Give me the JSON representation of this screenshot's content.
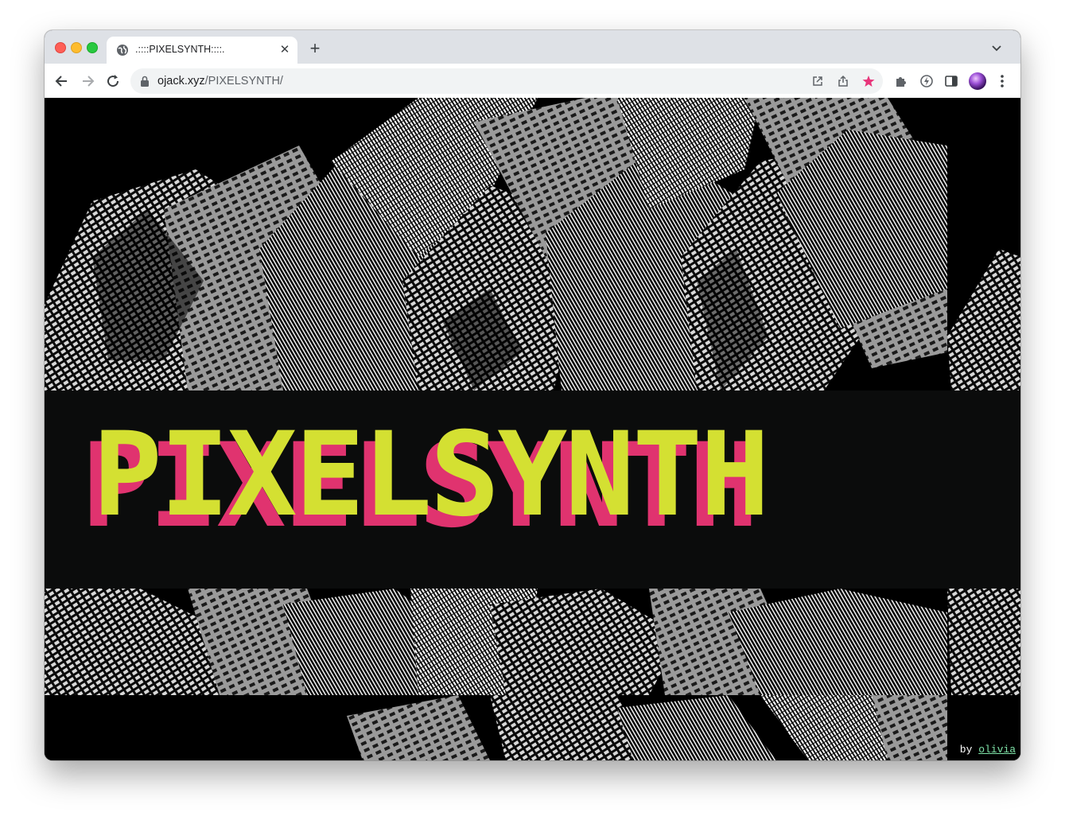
{
  "browser": {
    "tab": {
      "title": ".::::PIXELSYNTH::::.",
      "favicon": "globe-icon"
    },
    "address": {
      "domain": "ojack.xyz",
      "path": "/PIXELSYNTH/"
    },
    "icons": [
      "back-icon",
      "forward-icon",
      "reload-icon",
      "lock-icon",
      "open-in-new-icon",
      "share-icon",
      "bookmark-star-icon",
      "extensions-icon",
      "extension-icon",
      "side-panel-icon",
      "profile-avatar",
      "more-menu-icon"
    ],
    "colors": {
      "bookmark_star": "#e8357a"
    }
  },
  "page": {
    "title_text": "PIXELSYNTH",
    "colors": {
      "title_front": "#d4e032",
      "title_shadow": "#e0336f",
      "background": "#000000",
      "credit_link": "#7fe3a8"
    },
    "credit": {
      "prefix": "by ",
      "link_text": "olivia"
    }
  }
}
